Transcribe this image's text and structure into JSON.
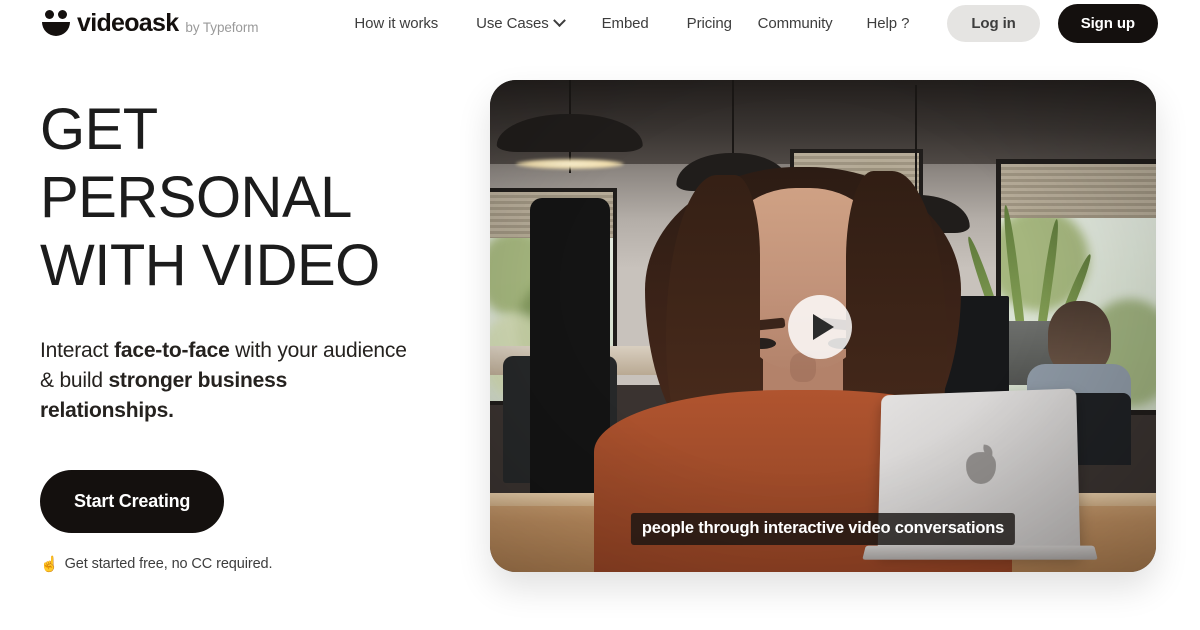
{
  "header": {
    "brand": {
      "icon": "videoask-smiley-logo",
      "word": "videoask",
      "byline": "by Typeform"
    },
    "nav_left": [
      {
        "label": "How it works",
        "has_chevron": false
      },
      {
        "label": "Use Cases",
        "has_chevron": true,
        "chevron_icon": "chevron-down-icon"
      },
      {
        "label": "Embed",
        "has_chevron": false
      },
      {
        "label": "Pricing",
        "has_chevron": false
      }
    ],
    "nav_right": [
      {
        "label": "Community"
      },
      {
        "label": "Help ?"
      }
    ],
    "login_label": "Log in",
    "signup_label": "Sign up",
    "login_bg": "#e5e4e2",
    "signup_bg": "#14100e"
  },
  "hero": {
    "headline": "Get\nPersonal\nWith Video",
    "subhead": {
      "part1": "Interact ",
      "bold1": "face-to-face",
      "part2": " with your audience & build ",
      "bold2": "stronger business relationships."
    },
    "cta_label": "Start Creating",
    "note_emoji": "☝",
    "note_text": "Get started free, no CC required.",
    "cta_bg": "#14100e"
  },
  "video": {
    "play_icon": "play-triangle-icon",
    "caption": "people through interactive video conversations",
    "scene_description": "Woman in rust sweater at a desk with a MacBook in a modern office"
  }
}
